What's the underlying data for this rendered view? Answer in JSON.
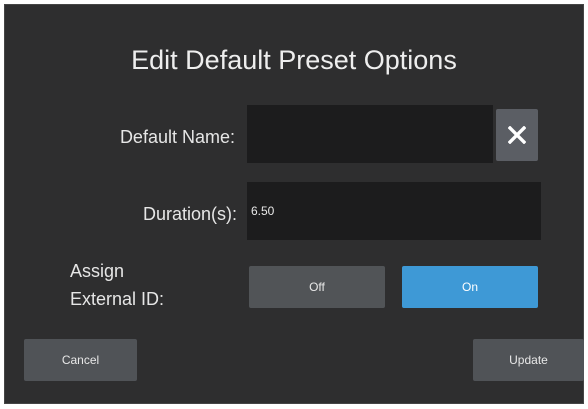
{
  "dialog": {
    "title": "Edit Default Preset Options"
  },
  "fields": {
    "default_name": {
      "label": "Default Name:",
      "value": "",
      "clear_icon": "close-icon"
    },
    "duration": {
      "label": "Duration(s):",
      "value": "6.50"
    }
  },
  "assign_external_id": {
    "label_line1": "Assign",
    "label_line2": "External ID:",
    "options": [
      "Off",
      "On"
    ],
    "selected": "On",
    "selected_color": "#3e99d6"
  },
  "actions": {
    "cancel_label": "Cancel",
    "update_label": "Update"
  }
}
